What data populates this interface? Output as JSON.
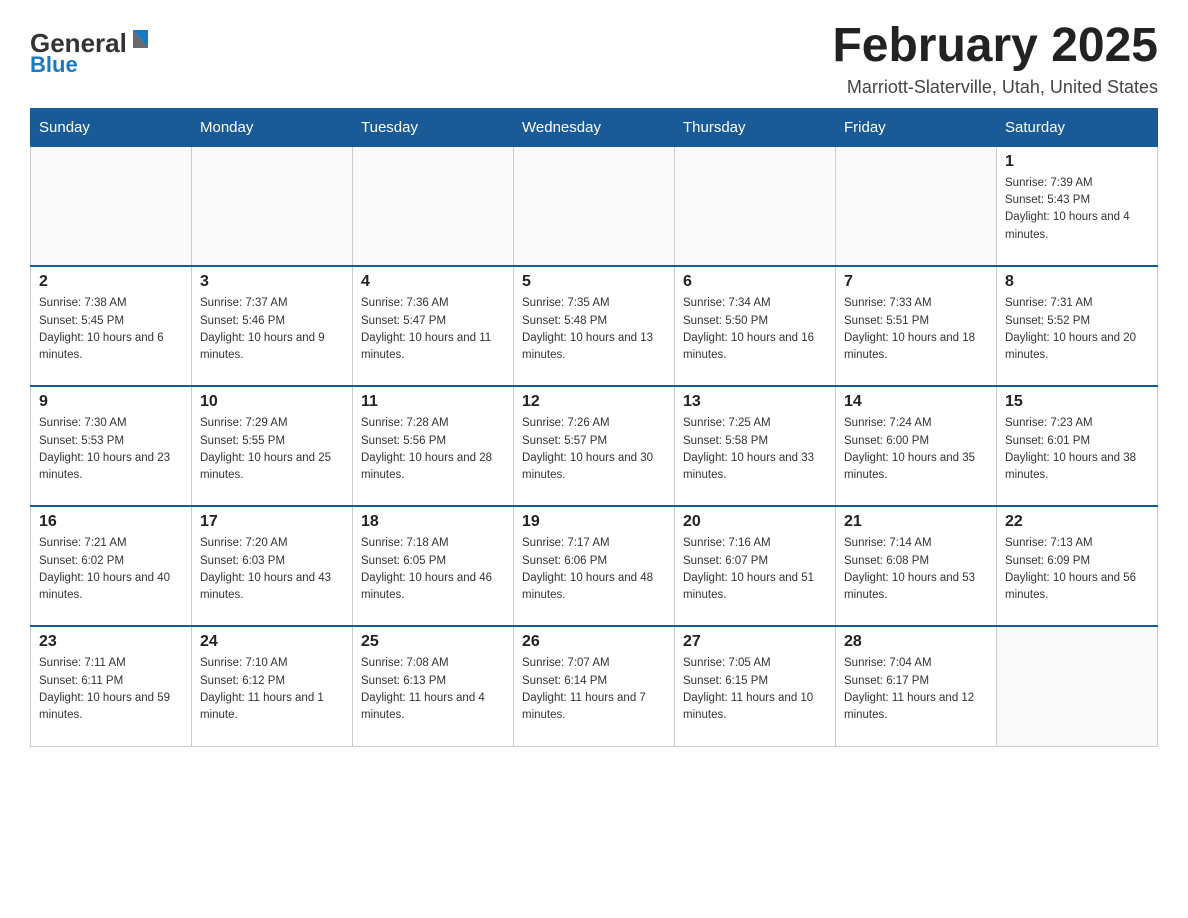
{
  "header": {
    "logo_general": "General",
    "logo_blue": "Blue",
    "month_title": "February 2025",
    "location": "Marriott-Slaterville, Utah, United States"
  },
  "days_of_week": [
    "Sunday",
    "Monday",
    "Tuesday",
    "Wednesday",
    "Thursday",
    "Friday",
    "Saturday"
  ],
  "weeks": [
    [
      {
        "day": "",
        "info": ""
      },
      {
        "day": "",
        "info": ""
      },
      {
        "day": "",
        "info": ""
      },
      {
        "day": "",
        "info": ""
      },
      {
        "day": "",
        "info": ""
      },
      {
        "day": "",
        "info": ""
      },
      {
        "day": "1",
        "info": "Sunrise: 7:39 AM\nSunset: 5:43 PM\nDaylight: 10 hours and 4 minutes."
      }
    ],
    [
      {
        "day": "2",
        "info": "Sunrise: 7:38 AM\nSunset: 5:45 PM\nDaylight: 10 hours and 6 minutes."
      },
      {
        "day": "3",
        "info": "Sunrise: 7:37 AM\nSunset: 5:46 PM\nDaylight: 10 hours and 9 minutes."
      },
      {
        "day": "4",
        "info": "Sunrise: 7:36 AM\nSunset: 5:47 PM\nDaylight: 10 hours and 11 minutes."
      },
      {
        "day": "5",
        "info": "Sunrise: 7:35 AM\nSunset: 5:48 PM\nDaylight: 10 hours and 13 minutes."
      },
      {
        "day": "6",
        "info": "Sunrise: 7:34 AM\nSunset: 5:50 PM\nDaylight: 10 hours and 16 minutes."
      },
      {
        "day": "7",
        "info": "Sunrise: 7:33 AM\nSunset: 5:51 PM\nDaylight: 10 hours and 18 minutes."
      },
      {
        "day": "8",
        "info": "Sunrise: 7:31 AM\nSunset: 5:52 PM\nDaylight: 10 hours and 20 minutes."
      }
    ],
    [
      {
        "day": "9",
        "info": "Sunrise: 7:30 AM\nSunset: 5:53 PM\nDaylight: 10 hours and 23 minutes."
      },
      {
        "day": "10",
        "info": "Sunrise: 7:29 AM\nSunset: 5:55 PM\nDaylight: 10 hours and 25 minutes."
      },
      {
        "day": "11",
        "info": "Sunrise: 7:28 AM\nSunset: 5:56 PM\nDaylight: 10 hours and 28 minutes."
      },
      {
        "day": "12",
        "info": "Sunrise: 7:26 AM\nSunset: 5:57 PM\nDaylight: 10 hours and 30 minutes."
      },
      {
        "day": "13",
        "info": "Sunrise: 7:25 AM\nSunset: 5:58 PM\nDaylight: 10 hours and 33 minutes."
      },
      {
        "day": "14",
        "info": "Sunrise: 7:24 AM\nSunset: 6:00 PM\nDaylight: 10 hours and 35 minutes."
      },
      {
        "day": "15",
        "info": "Sunrise: 7:23 AM\nSunset: 6:01 PM\nDaylight: 10 hours and 38 minutes."
      }
    ],
    [
      {
        "day": "16",
        "info": "Sunrise: 7:21 AM\nSunset: 6:02 PM\nDaylight: 10 hours and 40 minutes."
      },
      {
        "day": "17",
        "info": "Sunrise: 7:20 AM\nSunset: 6:03 PM\nDaylight: 10 hours and 43 minutes."
      },
      {
        "day": "18",
        "info": "Sunrise: 7:18 AM\nSunset: 6:05 PM\nDaylight: 10 hours and 46 minutes."
      },
      {
        "day": "19",
        "info": "Sunrise: 7:17 AM\nSunset: 6:06 PM\nDaylight: 10 hours and 48 minutes."
      },
      {
        "day": "20",
        "info": "Sunrise: 7:16 AM\nSunset: 6:07 PM\nDaylight: 10 hours and 51 minutes."
      },
      {
        "day": "21",
        "info": "Sunrise: 7:14 AM\nSunset: 6:08 PM\nDaylight: 10 hours and 53 minutes."
      },
      {
        "day": "22",
        "info": "Sunrise: 7:13 AM\nSunset: 6:09 PM\nDaylight: 10 hours and 56 minutes."
      }
    ],
    [
      {
        "day": "23",
        "info": "Sunrise: 7:11 AM\nSunset: 6:11 PM\nDaylight: 10 hours and 59 minutes."
      },
      {
        "day": "24",
        "info": "Sunrise: 7:10 AM\nSunset: 6:12 PM\nDaylight: 11 hours and 1 minute."
      },
      {
        "day": "25",
        "info": "Sunrise: 7:08 AM\nSunset: 6:13 PM\nDaylight: 11 hours and 4 minutes."
      },
      {
        "day": "26",
        "info": "Sunrise: 7:07 AM\nSunset: 6:14 PM\nDaylight: 11 hours and 7 minutes."
      },
      {
        "day": "27",
        "info": "Sunrise: 7:05 AM\nSunset: 6:15 PM\nDaylight: 11 hours and 10 minutes."
      },
      {
        "day": "28",
        "info": "Sunrise: 7:04 AM\nSunset: 6:17 PM\nDaylight: 11 hours and 12 minutes."
      },
      {
        "day": "",
        "info": ""
      }
    ]
  ]
}
